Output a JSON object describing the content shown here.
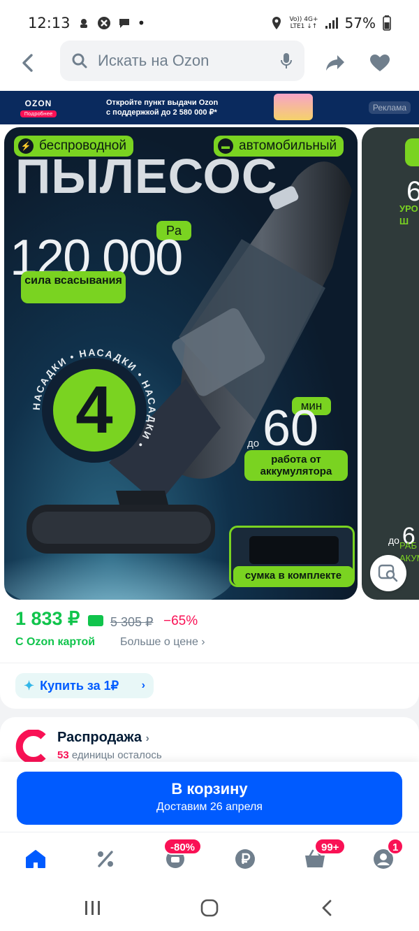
{
  "status_bar": {
    "time": "12:13",
    "network_top": "Vo)) 4G+",
    "network_bottom": "LTE1 ↓↑",
    "battery": "57%"
  },
  "search": {
    "placeholder": "Искать на Ozon"
  },
  "promo": {
    "brand": "OZON",
    "brand_button": "Подробнее",
    "text_line1": "Откройте пункт выдачи Ozon",
    "text_line2": "с поддержкой до 2 580 000 ₽*",
    "ad_label": "Реклама"
  },
  "product_image": {
    "tag_left": "беспроводной",
    "tag_right": "автомобильный",
    "title": "ПЫЛЕСОС",
    "suction_value": "120 000",
    "suction_unit": "Pa",
    "suction_label": "сила всасывания",
    "nozzles_count": "4",
    "nozzles_label": "НАСАДКИ",
    "battery_prefix": "до",
    "battery_value": "60",
    "battery_unit": "мин",
    "battery_label": "работа от аккумулятора",
    "bag_label": "сумка в комплекте"
  },
  "next_image": {
    "big": "6",
    "line1": "УРО",
    "line2": "Ш",
    "prefix": "до",
    "big2": "6",
    "line3": "РАБ",
    "line4": "АКУМ"
  },
  "price": {
    "current": "1 833 ₽",
    "old": "5 305 ₽",
    "discount": "−65%",
    "ozon_card": "С Ozon картой",
    "more": "Больше о цене ›"
  },
  "buy_for_one": {
    "label": "Купить за 1₽"
  },
  "sale": {
    "title": "Распродажа",
    "count": "53",
    "remaining": " единицы осталось"
  },
  "cart": {
    "label": "В корзину",
    "delivery": "Доставим 26 апреля"
  },
  "tabbar": {
    "badge_discount": "-80%",
    "badge_cart": "99+",
    "badge_profile": "1"
  },
  "colors": {
    "brand_blue": "#005bff",
    "price_green": "#10c44c",
    "discount_pink": "#f91155",
    "accent_green": "#7ad321"
  }
}
